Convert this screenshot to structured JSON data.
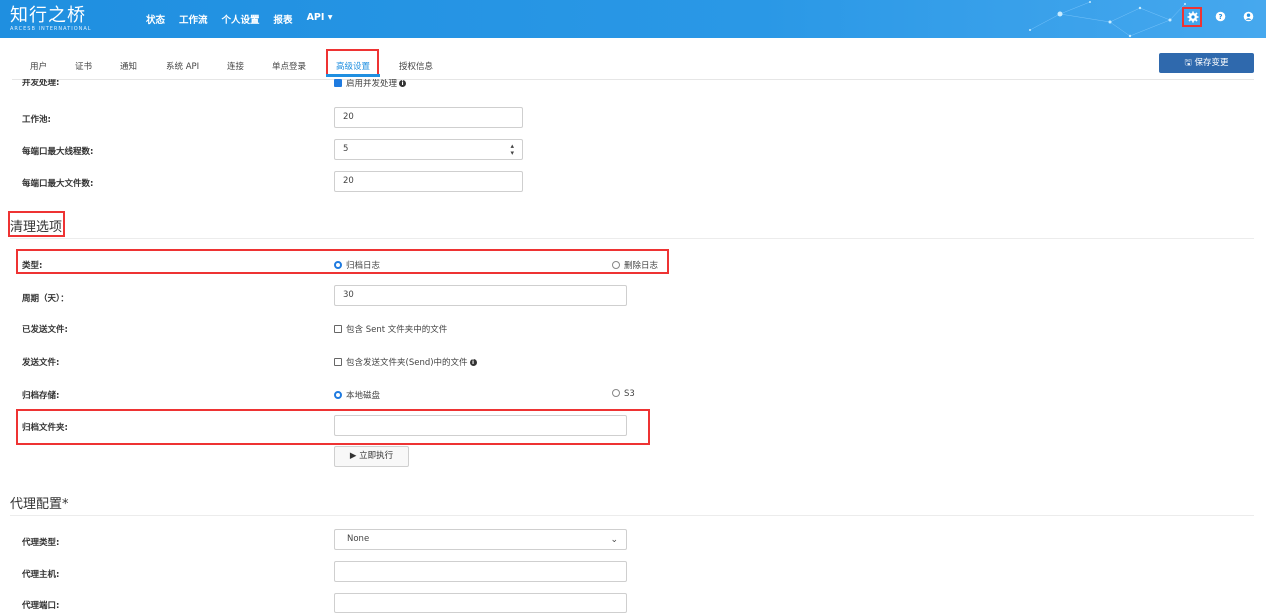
{
  "brand": {
    "name": "知行之桥",
    "tagline": "ARCESB INTERNATIONAL"
  },
  "nav": [
    "状态",
    "工作流",
    "个人设置",
    "报表",
    "API ▾"
  ],
  "top_icons": [
    "gear-icon",
    "help-icon",
    "user-icon"
  ],
  "tabs": [
    "用户",
    "证书",
    "通知",
    "系统 API",
    "连接",
    "单点登录",
    "高级设置",
    "授权信息"
  ],
  "save_label": "🖫 保存变更",
  "concurrency": {
    "partial_label": "并发处理:",
    "partial_option": "启用并发处理",
    "rows": [
      {
        "label": "工作池:",
        "value": "20"
      },
      {
        "label": "每端口最大线程数:",
        "value": "5"
      },
      {
        "label": "每端口最大文件数:",
        "value": "20"
      }
    ]
  },
  "cleanup": {
    "title": "清理选项",
    "type_label": "类型:",
    "type_options": [
      "归档日志",
      "删除日志"
    ],
    "period_label": "周期（天）：",
    "period_value": "30",
    "sent_label": "已发送文件:",
    "sent_option": "包含 Sent 文件夹中的文件",
    "send_label": "发送文件:",
    "send_option": "包含发送文件夹(Send)中的文件",
    "storage_label": "归档存储:",
    "storage_options": [
      "本地磁盘",
      "S3"
    ],
    "folder_label": "归档文件夹:",
    "folder_value": "",
    "run_label": "▶ 立即执行"
  },
  "proxy": {
    "title": "代理配置*",
    "type_label": "代理类型:",
    "type_value": "None",
    "host_label": "代理主机:",
    "port_label": "代理端口:"
  },
  "colors": {
    "topbar": "#1f8fe0",
    "accent": "#1f7be0",
    "save_button": "#2f69ad",
    "highlight": "#e33333"
  }
}
